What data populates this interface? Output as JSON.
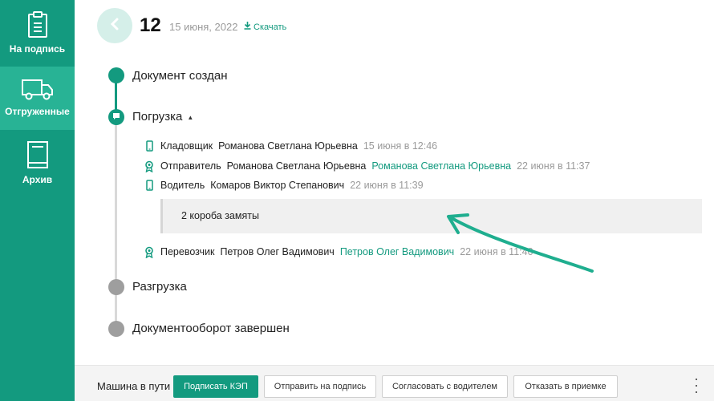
{
  "sidebar": {
    "items": [
      {
        "label": "На подпись",
        "icon": "clipboard-icon",
        "active": false
      },
      {
        "label": "Отгруженные",
        "icon": "truck-icon",
        "active": true
      },
      {
        "label": "Архив",
        "icon": "book-icon",
        "active": false
      }
    ]
  },
  "header": {
    "number": "12",
    "date": "15 июня, 2022",
    "download_label": "Скачать"
  },
  "timeline": {
    "steps": [
      {
        "title": "Документ создан",
        "state": "done"
      },
      {
        "title": "Погрузка",
        "state": "current"
      },
      {
        "title": "Разгрузка",
        "state": "pending"
      },
      {
        "title": "Документооборот завершен",
        "state": "pending"
      }
    ],
    "signatures": [
      {
        "icon": "phone-icon",
        "role": "Кладовщик",
        "name": "Романова Светлана Юрьевна",
        "signer": "",
        "time": "15 июня в 12:46"
      },
      {
        "icon": "certificate-icon",
        "role": "Отправитель",
        "name": "Романова Светлана Юрьевна",
        "signer": "Романова Светлана Юрьевна",
        "time": "22 июня в 11:37"
      },
      {
        "icon": "phone-icon",
        "role": "Водитель",
        "name": "Комаров Виктор Степанович",
        "signer": "",
        "time": "22 июня в 11:39"
      },
      {
        "icon": "certificate-icon",
        "role": "Перевозчик",
        "name": "Петров Олег Вадимович",
        "signer": "Петров Олег Вадимович",
        "time": "22 июня в 11:40"
      }
    ],
    "comment": "2 короба замяты"
  },
  "footer": {
    "status": "Машина в пути",
    "buttons": {
      "sign": "Подписать КЭП",
      "send": "Отправить на подпись",
      "agree": "Согласовать с водителем",
      "refuse": "Отказать в приемке"
    }
  },
  "colors": {
    "accent": "#139a7f",
    "sidebar_active": "#28b395",
    "muted": "#9a9a9a",
    "pending_dot": "#9e9e9e"
  }
}
